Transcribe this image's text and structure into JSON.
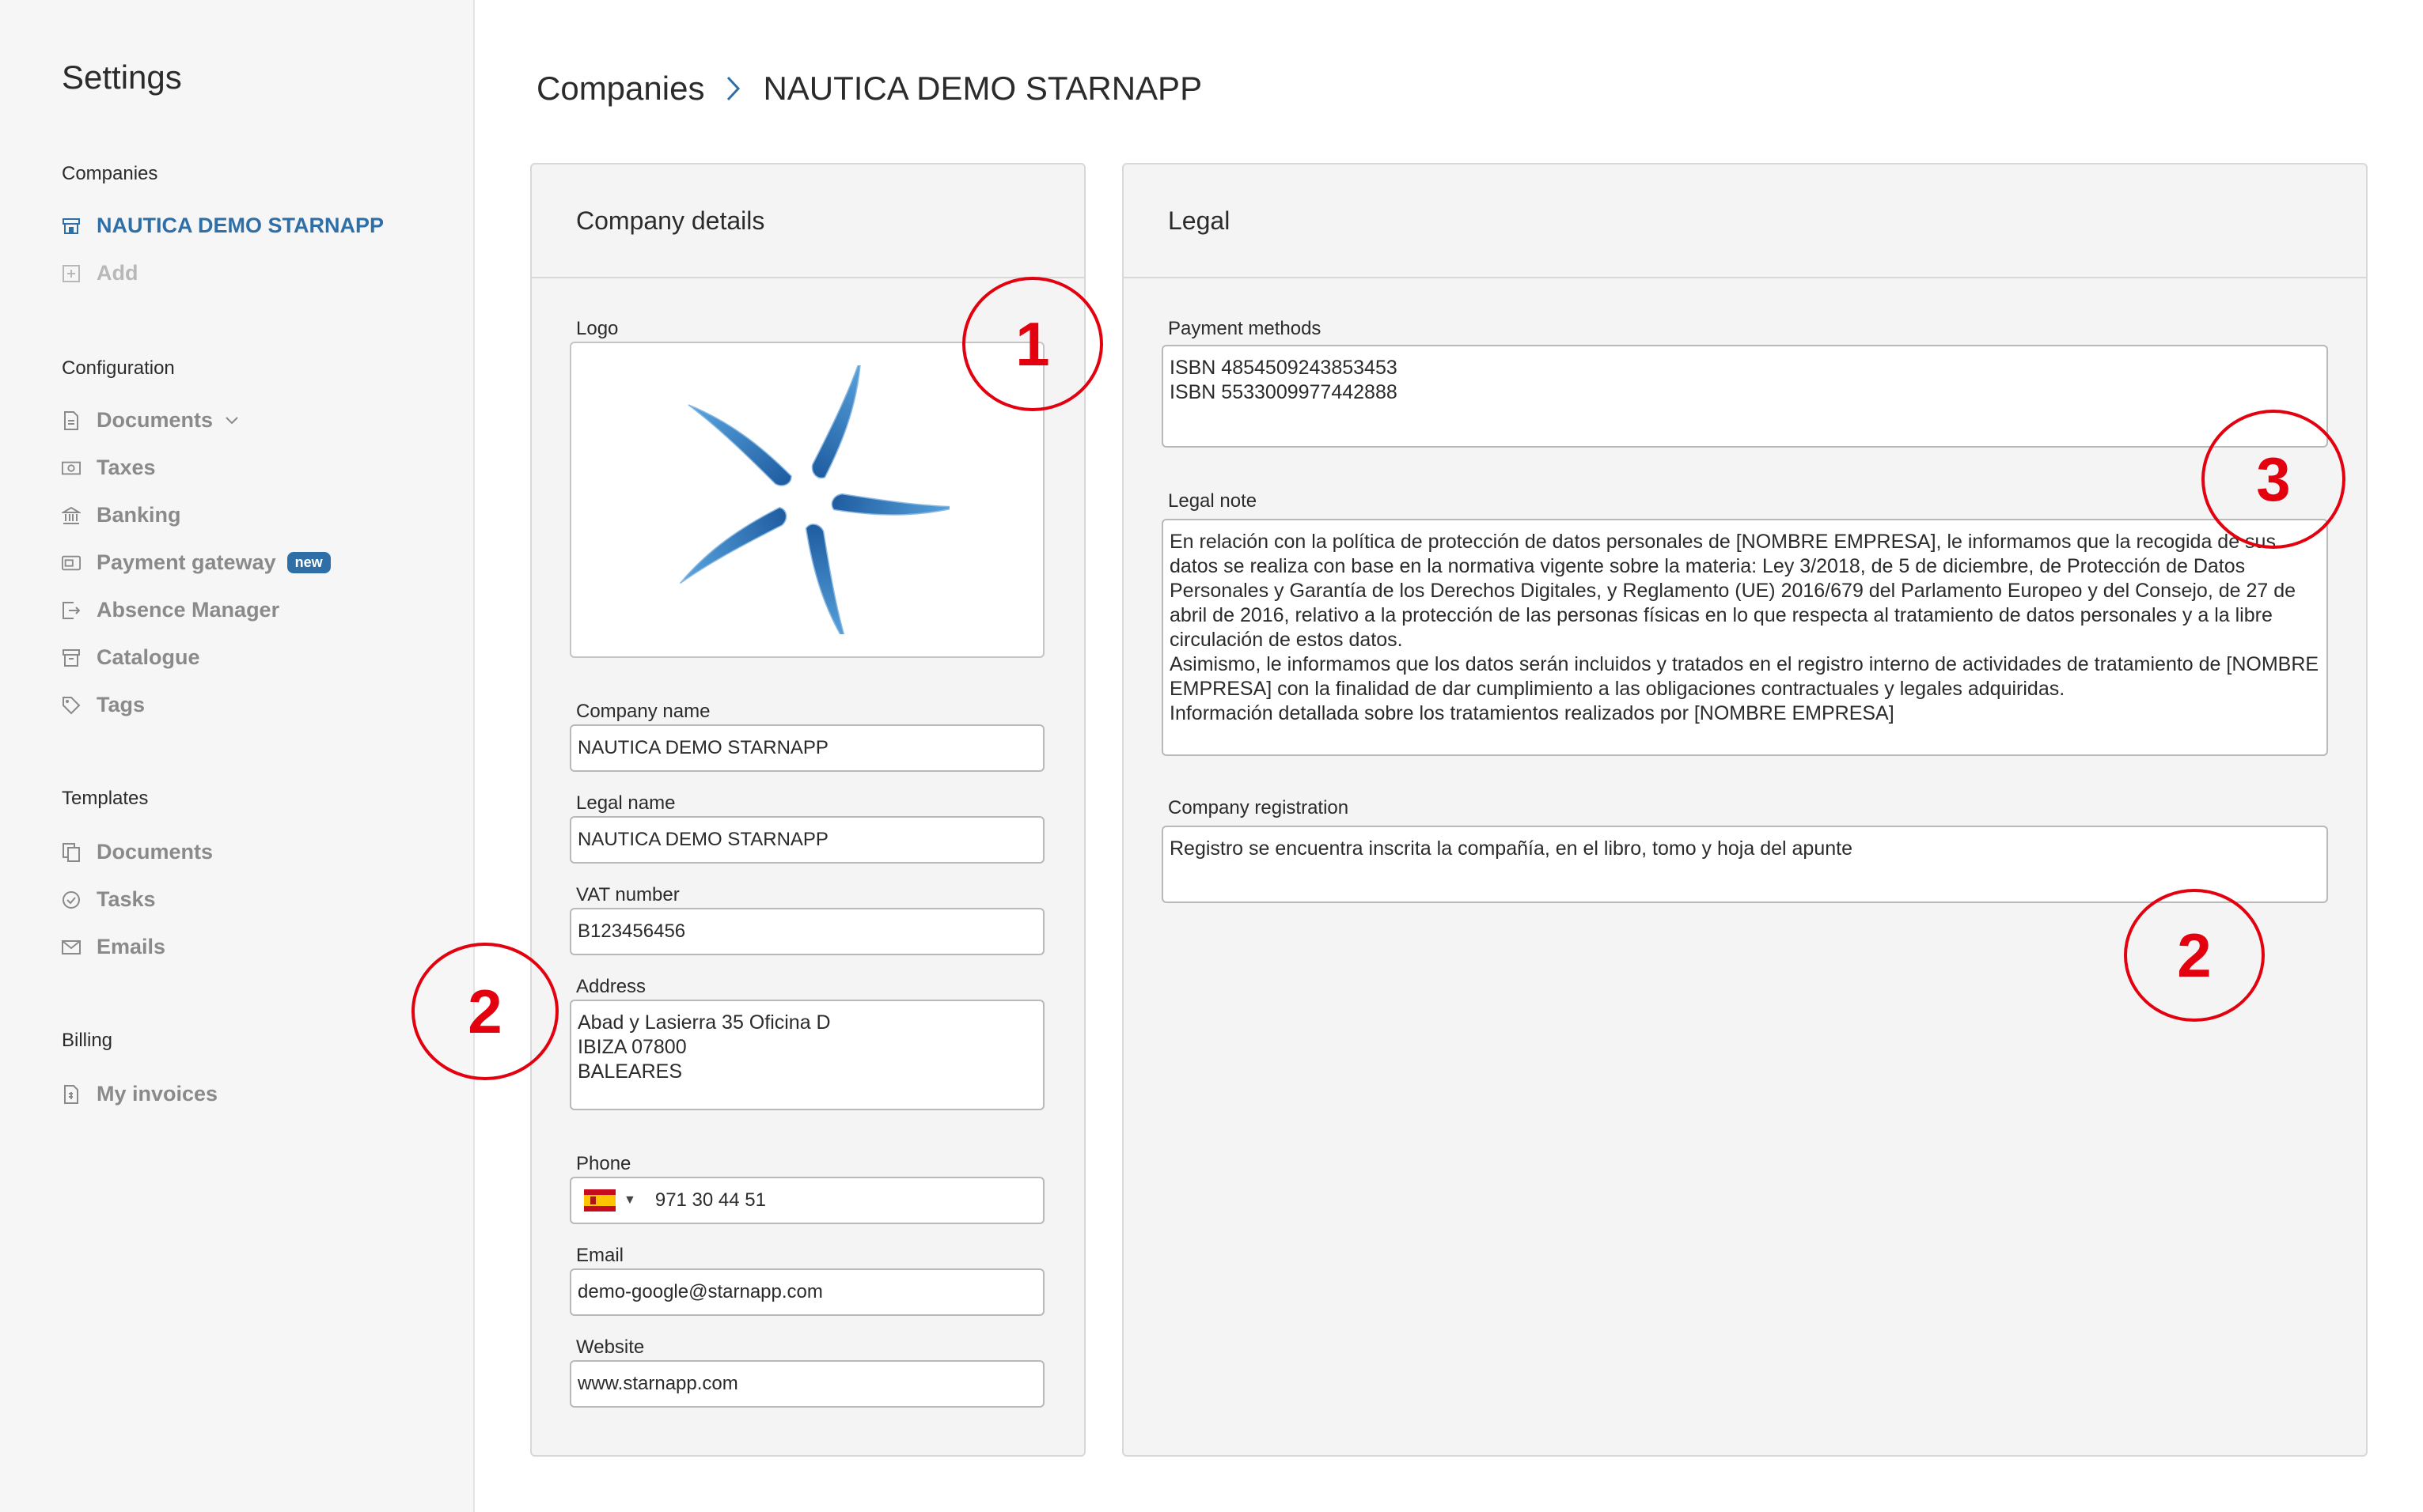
{
  "sidebar": {
    "title": "Settings",
    "companies": {
      "heading": "Companies",
      "items": [
        {
          "label": "NAUTICA DEMO STARNAPP",
          "icon": "store-icon"
        },
        {
          "label": "Add",
          "icon": "plus-square-icon"
        }
      ]
    },
    "configuration": {
      "heading": "Configuration",
      "items": [
        {
          "label": "Documents",
          "icon": "document-icon"
        },
        {
          "label": "Taxes",
          "icon": "money-icon"
        },
        {
          "label": "Banking",
          "icon": "bank-icon"
        },
        {
          "label": "Payment gateway",
          "icon": "payment-gateway-icon",
          "badge": "new"
        },
        {
          "label": "Absence Manager",
          "icon": "exit-icon"
        },
        {
          "label": "Catalogue",
          "icon": "archive-icon"
        },
        {
          "label": "Tags",
          "icon": "tag-icon"
        }
      ]
    },
    "templates": {
      "heading": "Templates",
      "items": [
        {
          "label": "Documents",
          "icon": "copy-icon"
        },
        {
          "label": "Tasks",
          "icon": "check-circle-icon"
        },
        {
          "label": "Emails",
          "icon": "mail-icon"
        }
      ]
    },
    "billing": {
      "heading": "Billing",
      "items": [
        {
          "label": "My invoices",
          "icon": "invoice-icon"
        }
      ]
    }
  },
  "breadcrumb": {
    "parent": "Companies",
    "current": "NAUTICA DEMO STARNAPP"
  },
  "company_details": {
    "title": "Company details",
    "logo_label": "Logo",
    "company_name_label": "Company name",
    "company_name": "NAUTICA DEMO STARNAPP",
    "legal_name_label": "Legal name",
    "legal_name": "NAUTICA DEMO STARNAPP",
    "vat_label": "VAT number",
    "vat": "B123456456",
    "address_label": "Address",
    "address": "Abad y Lasierra 35 Oficina D\nIBIZA 07800\nBALEARES",
    "phone_label": "Phone",
    "phone": "971 30 44 51",
    "email_label": "Email",
    "email": "demo-google@starnapp.com",
    "website_label": "Website",
    "website": "www.starnapp.com"
  },
  "legal": {
    "title": "Legal",
    "payment_methods_label": "Payment methods",
    "payment_methods": "ISBN 4854509243853453\nISBN 5533009977442888",
    "legal_note_label": "Legal note",
    "legal_note": "En relación con la política de protección de datos personales de [NOMBRE EMPRESA], le informamos que la recogida de sus datos se realiza con base en la normativa vigente sobre la materia: Ley 3/2018, de 5 de diciembre, de Protección de Datos Personales y Garantía de los Derechos Digitales, y Reglamento (UE) 2016/679 del Parlamento Europeo y del Consejo, de 27 de abril de 2016, relativo a la protección de las personas físicas en lo que respecta al tratamiento de datos personales y a la libre circulación de estos datos.\nAsimismo, le informamos que los datos serán incluidos y tratados en el registro interno de actividades de tratamiento de [NOMBRE EMPRESA] con la finalidad de dar cumplimiento a las obligaciones contractuales y legales adquiridas.\nInformación detallada sobre los tratamientos realizados por [NOMBRE EMPRESA]",
    "company_registration_label": "Company registration",
    "company_registration": "Registro se encuentra inscrita la compañía, en el libro, tomo y hoja del apunte"
  },
  "annotations": [
    "1",
    "2",
    "3",
    "2"
  ],
  "colors": {
    "accent": "#2f6fa8",
    "annotation": "#e3000f",
    "sidebar_bg": "#f6f6f6",
    "card_bg": "#f4f4f4"
  }
}
